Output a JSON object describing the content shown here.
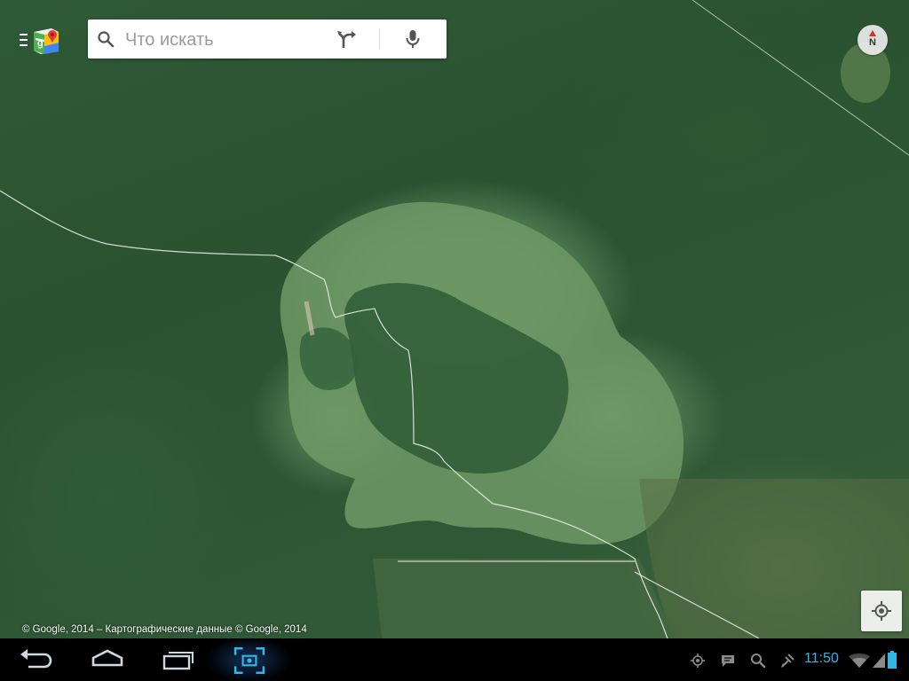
{
  "search": {
    "placeholder": "Что искать"
  },
  "compass": {
    "label": "N"
  },
  "attribution": {
    "text": "© Google, 2014 – Картографические данные © Google, 2014"
  },
  "status_bar": {
    "time": "11:50"
  },
  "colors": {
    "accent_blue": "#33b5e5",
    "compass_red": "#d8302b"
  },
  "icons": {
    "menu": "menu-icon",
    "maps_logo": "google-maps-logo-icon",
    "search": "search-icon",
    "directions": "directions-icon",
    "voice": "microphone-icon",
    "compass": "compass-icon",
    "my_location": "my-location-icon",
    "back": "back-icon",
    "home": "home-icon",
    "recents": "recent-apps-icon",
    "screenshot": "screenshot-icon",
    "gps": "gps-icon",
    "message": "message-icon",
    "search_status": "search-icon",
    "usb_debug": "usb-debug-icon",
    "wifi": "wifi-icon",
    "battery": "battery-icon"
  }
}
